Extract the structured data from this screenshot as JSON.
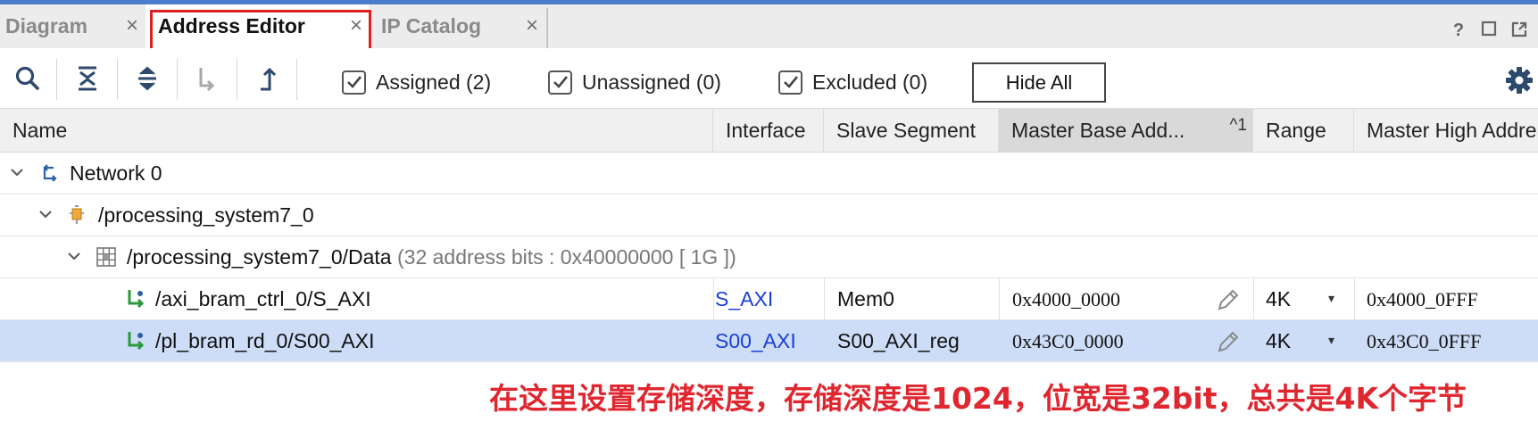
{
  "tabs": [
    {
      "label": "Diagram",
      "close": "×"
    },
    {
      "label": "Address Editor",
      "close": "×"
    },
    {
      "label": "IP Catalog",
      "close": "×"
    }
  ],
  "window_controls": {
    "help": "?"
  },
  "toolbar": {
    "filters": [
      {
        "label": "Assigned (2)",
        "checked": true
      },
      {
        "label": "Unassigned (0)",
        "checked": true
      },
      {
        "label": "Excluded (0)",
        "checked": true
      }
    ],
    "hide_all": "Hide All"
  },
  "columns": {
    "name": "Name",
    "interface": "Interface",
    "slave_segment": "Slave Segment",
    "master_base": "Master Base Add...",
    "sort_indicator": "^1",
    "range": "Range",
    "master_high": "Master High Addre"
  },
  "tree": {
    "network": "Network 0",
    "processor": "/processing_system7_0",
    "data_space": "/processing_system7_0/Data",
    "data_space_detail": "(32 address bits : 0x40000000 [ 1G ])",
    "rows": [
      {
        "name": "/axi_bram_ctrl_0/S_AXI",
        "interface": "S_AXI",
        "slave_segment": "Mem0",
        "master_base": "0x4000_0000",
        "range": "4K",
        "master_high": "0x4000_0FFF",
        "selected": false
      },
      {
        "name": "/pl_bram_rd_0/S00_AXI",
        "interface": "S00_AXI",
        "slave_segment": "S00_AXI_reg",
        "master_base": "0x43C0_0000",
        "range": "4K",
        "master_high": "0x43C0_0FFF",
        "selected": true
      }
    ]
  },
  "annotation": "在这里设置存储深度，存储深度是1024，位宽是32bit，总共是4K个字节",
  "colors": {
    "accent": "#4a7ec8",
    "selection": "#cdddf7",
    "link": "#1a3fd8",
    "annotation": "#e0262f",
    "highlight_box": "#e02020"
  }
}
